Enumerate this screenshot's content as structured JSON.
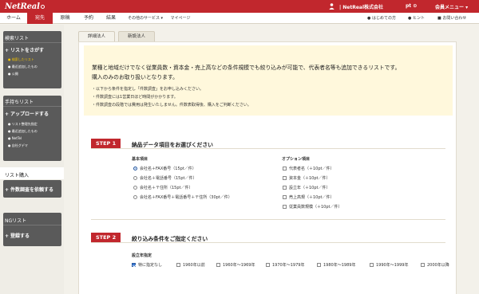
{
  "brand": {
    "name": "NetReal",
    "color": "#c1272d"
  },
  "topbar": {
    "company": "| NetReal株式会社",
    "point": "pt ⊙",
    "member_menu": "会員メニュー ▾"
  },
  "nav": {
    "items": [
      "ホーム",
      "宛先",
      "原稿",
      "予約",
      "結果",
      "その他のサービス ▾",
      "マイページ"
    ],
    "active_index": 1,
    "help": "はじめての方",
    "hint": "ヒント",
    "contact": "お問い合わせ"
  },
  "sidebar": {
    "search_list": {
      "title": "検索リスト",
      "button": "リストをさがす",
      "subs": [
        "検索したリスト",
        "最近追加したもの",
        "公開"
      ]
    },
    "own_list": {
      "title": "手持ちリスト",
      "button": "アップロードする",
      "subs": [
        "リスト整理先指定",
        "最近追加したもの",
        "NetTel",
        "自社グデマ"
      ]
    },
    "purchase": {
      "title": "リスト購入",
      "button": "件数調査を依頼する"
    },
    "ng_list": {
      "title": "NGリスト",
      "button": "登録する"
    }
  },
  "tabs": [
    "詳細法人",
    "新設法人"
  ],
  "intro": {
    "line1": "業種と地域だけでなく従業員数・資本金・売上高などの条件規模でも絞り込みが可能で、代表者名等も追加できるリストです。",
    "line2": "購入のみのお取り扱いとなります。",
    "bullets": [
      "以下から条件を指定し「件数調査」をお申し込みください。",
      "件数調査には1営業日ほど時間がかかります。",
      "件数調査の段階では費用は発生いたしません。件数表取得後、購入をご判断ください。"
    ]
  },
  "step1": {
    "badge": "STEP 1",
    "title": "納品データ項目をお選びください",
    "basic_label": "基本項目",
    "basic_options": [
      "会社名＋FAX番号（15pt／件）",
      "会社名＋電話番号（15pt／件）",
      "会社名＋〒住所（15pt／件）",
      "会社名＋FAX番号＋電話番号＋〒住所（30pt／件）"
    ],
    "basic_selected": 0,
    "option_label": "オプション項目",
    "option_items": [
      "代表者名（＋10pt／件）",
      "資本金（＋10pt／件）",
      "設立年（＋10pt／件）",
      "売上高規（＋10pt／件）",
      "従業員数規模（＋10pt／件）"
    ]
  },
  "step2": {
    "badge": "STEP 2",
    "title": "絞り込み条件をご指定ください",
    "year_label": "設立年指定",
    "year_options": [
      "特に指定なし",
      "1960年以前",
      "1960年〜1969年",
      "1970年〜1979年",
      "1980年〜1989年",
      "1990年〜1999年",
      "2000年以降"
    ],
    "year_checked": 0
  }
}
